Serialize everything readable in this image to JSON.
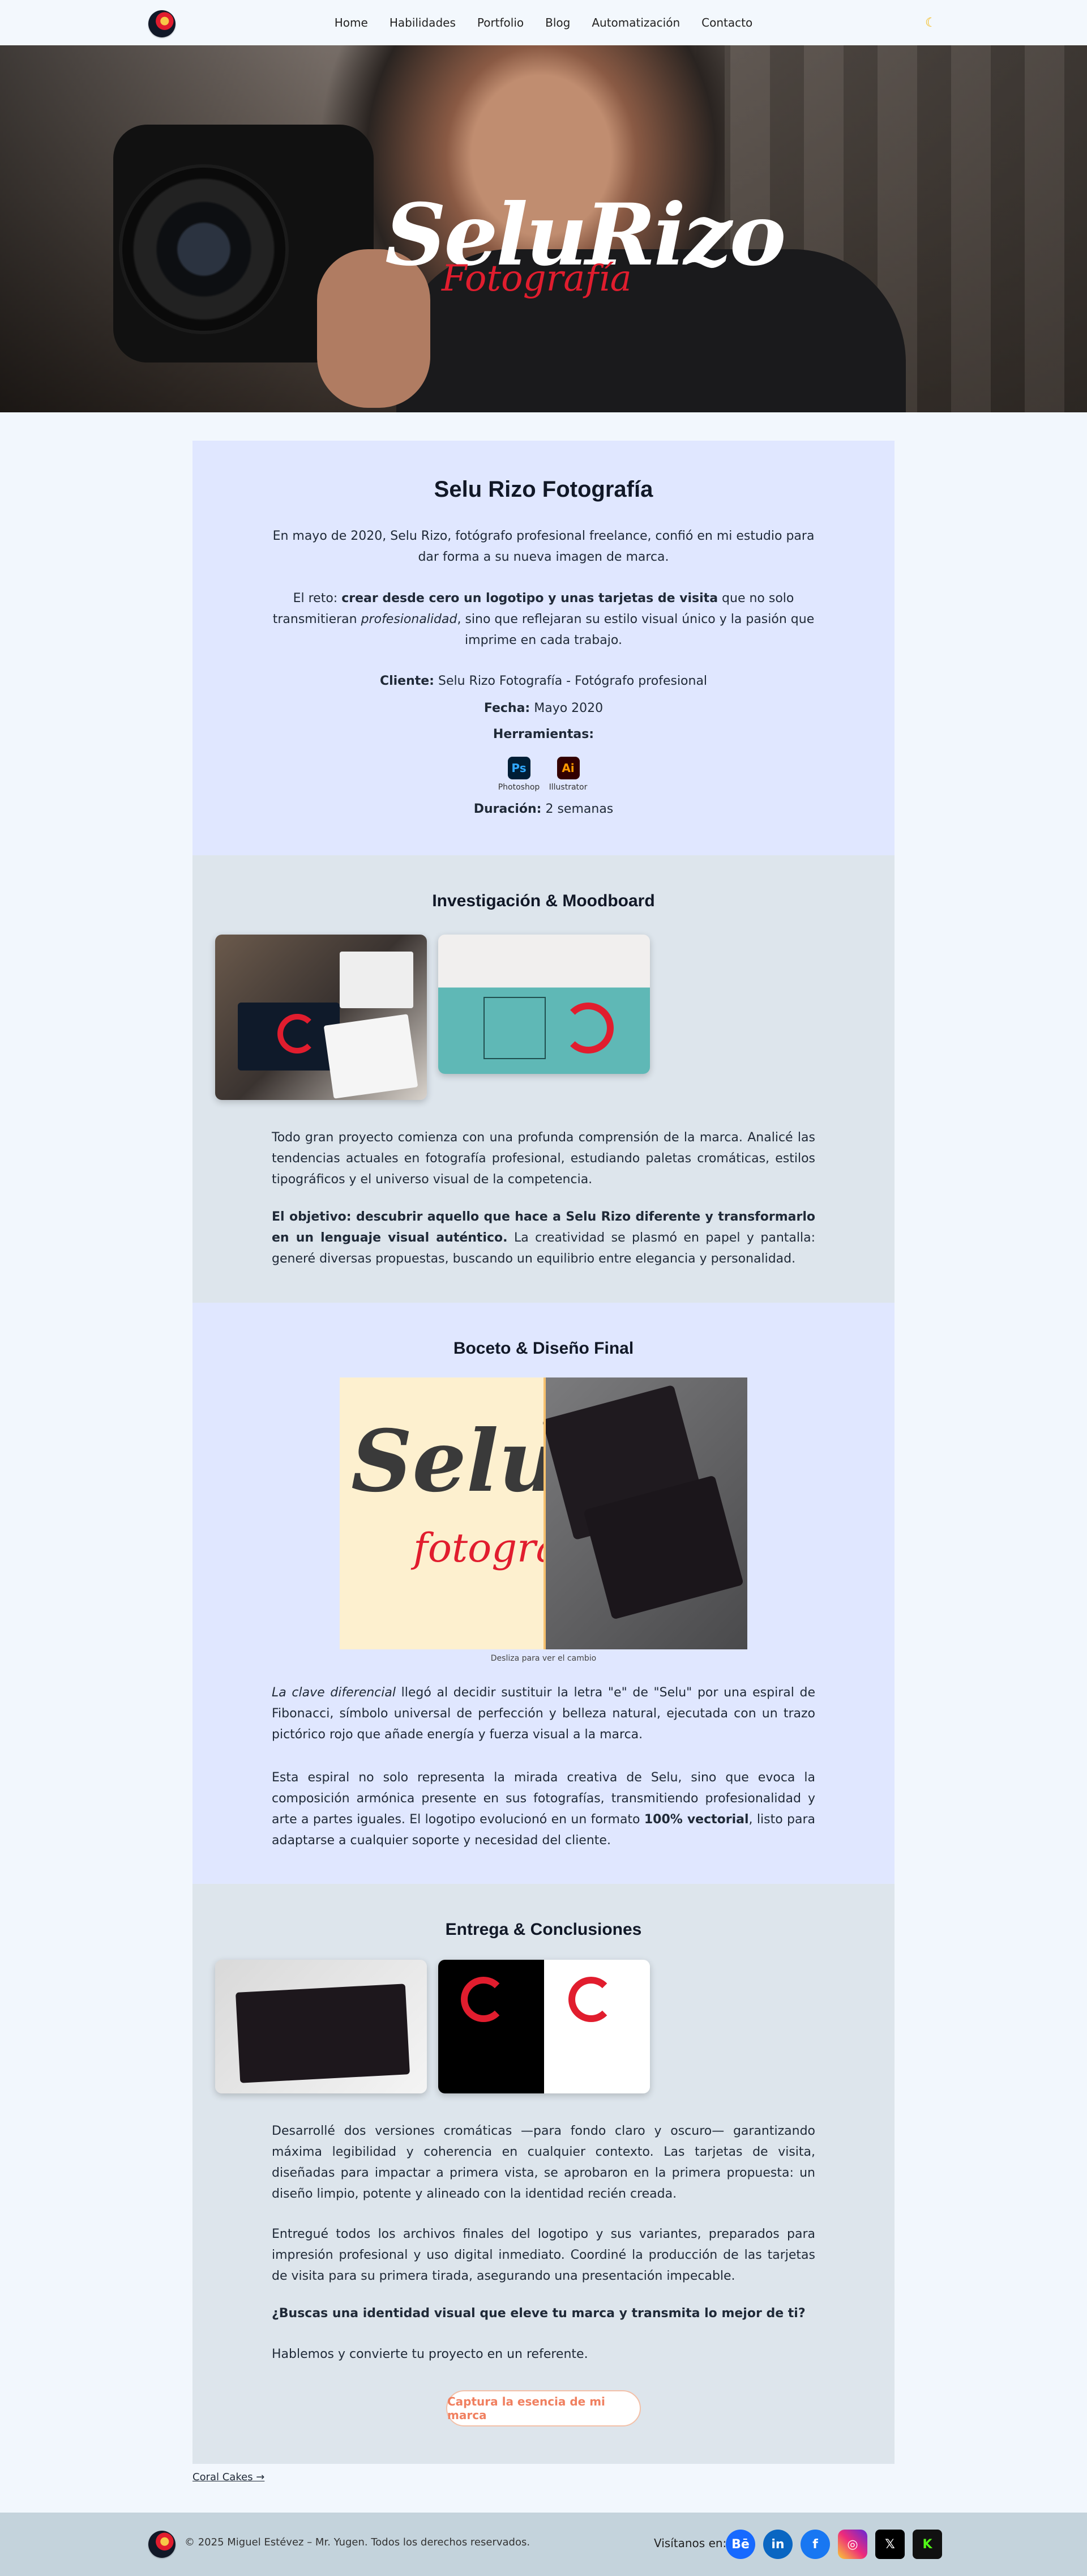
{
  "nav": {
    "items": [
      "Home",
      "Habilidades",
      "Portfolio",
      "Blog",
      "Automatización",
      "Contacto"
    ],
    "theme_icon": "moon-icon"
  },
  "hero": {
    "brand_main": "SeluRizo",
    "brand_sub": "Fotografía"
  },
  "intro": {
    "title": "Selu Rizo Fotografía",
    "p1": "En mayo de 2020, Selu Rizo, fotógrafo profesional freelance, confió en mi estudio para dar forma a su nueva imagen de marca.",
    "p2_pre": "El reto: ",
    "p2_bold": "crear desde cero un logotipo y unas tarjetas de visita",
    "p2_mid": " que no solo transmitieran ",
    "p2_em": "profesionalidad",
    "p2_post": ", sino que reflejaran su estilo visual único y la pasión que imprime en cada trabajo.",
    "client_label": "Cliente:",
    "client_value": "Selu Rizo Fotografía - Fotógrafo profesional",
    "date_label": "Fecha:",
    "date_value": "Mayo 2020",
    "tools_label": "Herramientas:",
    "tools": [
      {
        "abbr": "Ps",
        "name": "Photoshop"
      },
      {
        "abbr": "Ai",
        "name": "Illustrator"
      }
    ],
    "duration_label": "Duración:",
    "duration_value": "2 semanas"
  },
  "research": {
    "title": "Investigación & Moodboard",
    "p1": "Todo gran proyecto comienza con una profunda comprensión de la marca. Analicé las tendencias actuales en fotografía profesional, estudiando paletas cromáticas, estilos tipográficos y el universo visual de la competencia.",
    "p2_bold": "El objetivo: descubrir aquello que hace a Selu Rizo diferente y transformarlo en un lenguaje visual auténtico.",
    "p2_post": " La creatividad se plasmó en papel y pantalla: generé diversas propuestas, buscando un equilibrio entre elegancia y personalidad."
  },
  "sketch": {
    "title": "Boceto & Diseño Final",
    "slider_caption": "Desliza para ver el cambio",
    "left_brand": "Selu",
    "left_sub": "fotografía",
    "p1_em": "La clave diferencial",
    "p1_post": " llegó al decidir sustituir la letra \"e\" de \"Selu\" por una espiral de Fibonacci, símbolo universal de perfección y belleza natural, ejecutada con un trazo pictórico rojo que añade energía y fuerza visual a la marca.",
    "p2_pre": "Esta espiral no solo representa la mirada creativa de Selu, sino que evoca la composición armónica presente en sus fotografías, transmitiendo profesionalidad y arte a partes iguales. El logotipo evolucionó en un formato ",
    "p2_bold": "100% vectorial",
    "p2_post": ", listo para adaptarse a cualquier soporte y necesidad del cliente."
  },
  "delivery": {
    "title": "Entrega & Conclusiones",
    "p1": "Desarrollé dos versiones cromáticas —para fondo claro y oscuro— garantizando máxima legibilidad y coherencia en cualquier contexto. Las tarjetas de visita, diseñadas para impactar a primera vista, se aprobaron en la primera propuesta: un diseño limpio, potente y alineado con la identidad recién creada.",
    "p2": "Entregué todos los archivos finales del logotipo y sus variantes, preparados para impresión profesional y uso digital inmediato. Coordiné la producción de las tarjetas de visita para su primera tirada, asegurando una presentación impecable.",
    "question": "¿Buscas una identidad visual que eleve tu marca y transmita lo mejor de ti?",
    "p3": "Hablemos y convierte tu proyecto en un referente.",
    "cta": "Captura la esencia de mi marca"
  },
  "next_link": "Coral Cakes →",
  "footer": {
    "copyright": "© 2025 Miguel Estévez – Mr. Yugen. Todos los derechos reservados.",
    "social_label": "Visítanos en:",
    "social": [
      {
        "name": "behance-icon",
        "glyph": "Bē",
        "color": "#1769ff"
      },
      {
        "name": "linkedin-icon",
        "glyph": "in",
        "color": "#0a66c2"
      },
      {
        "name": "facebook-icon",
        "glyph": "f",
        "color": "#1877f2"
      },
      {
        "name": "instagram-icon",
        "glyph": "◎",
        "color": "#d6249f"
      },
      {
        "name": "x-icon",
        "glyph": "𝕏",
        "color": "#000000"
      },
      {
        "name": "kick-icon",
        "glyph": "K",
        "color": "#111111"
      }
    ]
  }
}
